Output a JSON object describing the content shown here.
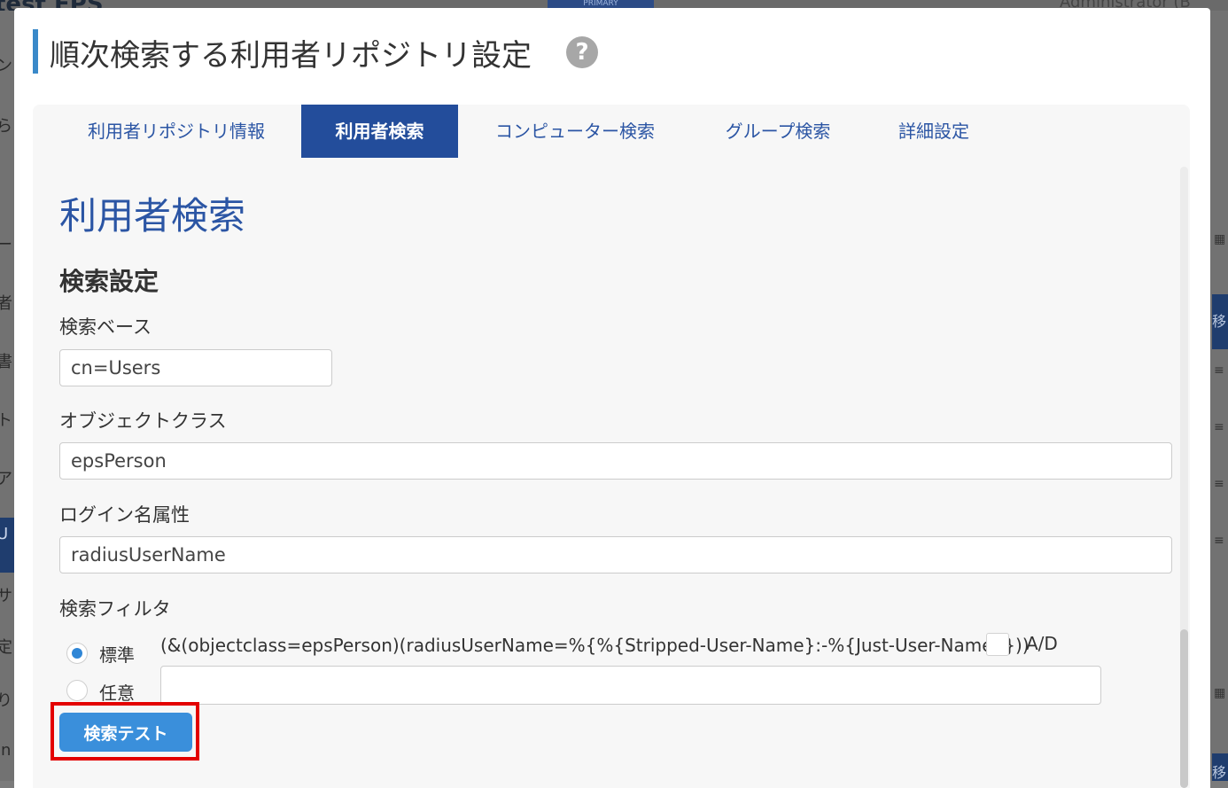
{
  "background": {
    "logo_text": "test EPS",
    "badge": "PRIMARY",
    "user": "Administrator (B",
    "right_blue_1": "移",
    "right_blue_2": "移",
    "left_chars": [
      "ン",
      "ら",
      "ー",
      "者",
      "書",
      "ト",
      "ア",
      "U",
      "サ",
      "定",
      "り",
      "in"
    ]
  },
  "modal": {
    "title": "順次検索する利用者リポジトリ設定",
    "help_icon": "question-circle-icon"
  },
  "tabs": [
    {
      "label": "利用者リポジトリ情報",
      "active": false
    },
    {
      "label": "利用者検索",
      "active": true
    },
    {
      "label": "コンピューター検索",
      "active": false
    },
    {
      "label": "グループ検索",
      "active": false
    },
    {
      "label": "詳細設定",
      "active": false
    }
  ],
  "section": {
    "title": "利用者検索",
    "subtitle": "検索設定"
  },
  "fields": {
    "search_base": {
      "label": "検索ベース",
      "value": "cn=Users"
    },
    "object_class": {
      "label": "オブジェクトクラス",
      "value": "epsPerson"
    },
    "login_attr": {
      "label": "ログイン名属性",
      "value": "radiusUserName"
    }
  },
  "filter": {
    "label": "検索フィルタ",
    "options": [
      {
        "label": "標準",
        "selected": true
      },
      {
        "label": "任意",
        "selected": false
      }
    ],
    "standard_value": "(&(objectclass=epsPerson)(radiusUserName=%{%{Stripped-User-Name}:-%{Just-User-Name}}))",
    "ad_label": "A/D",
    "ad_checked": false,
    "custom_value": ""
  },
  "buttons": {
    "search_test": "検索テスト"
  },
  "colors": {
    "accent": "#234d9b",
    "link": "#2b55a4",
    "button": "#3a8fdb",
    "highlight": "#e30000"
  }
}
